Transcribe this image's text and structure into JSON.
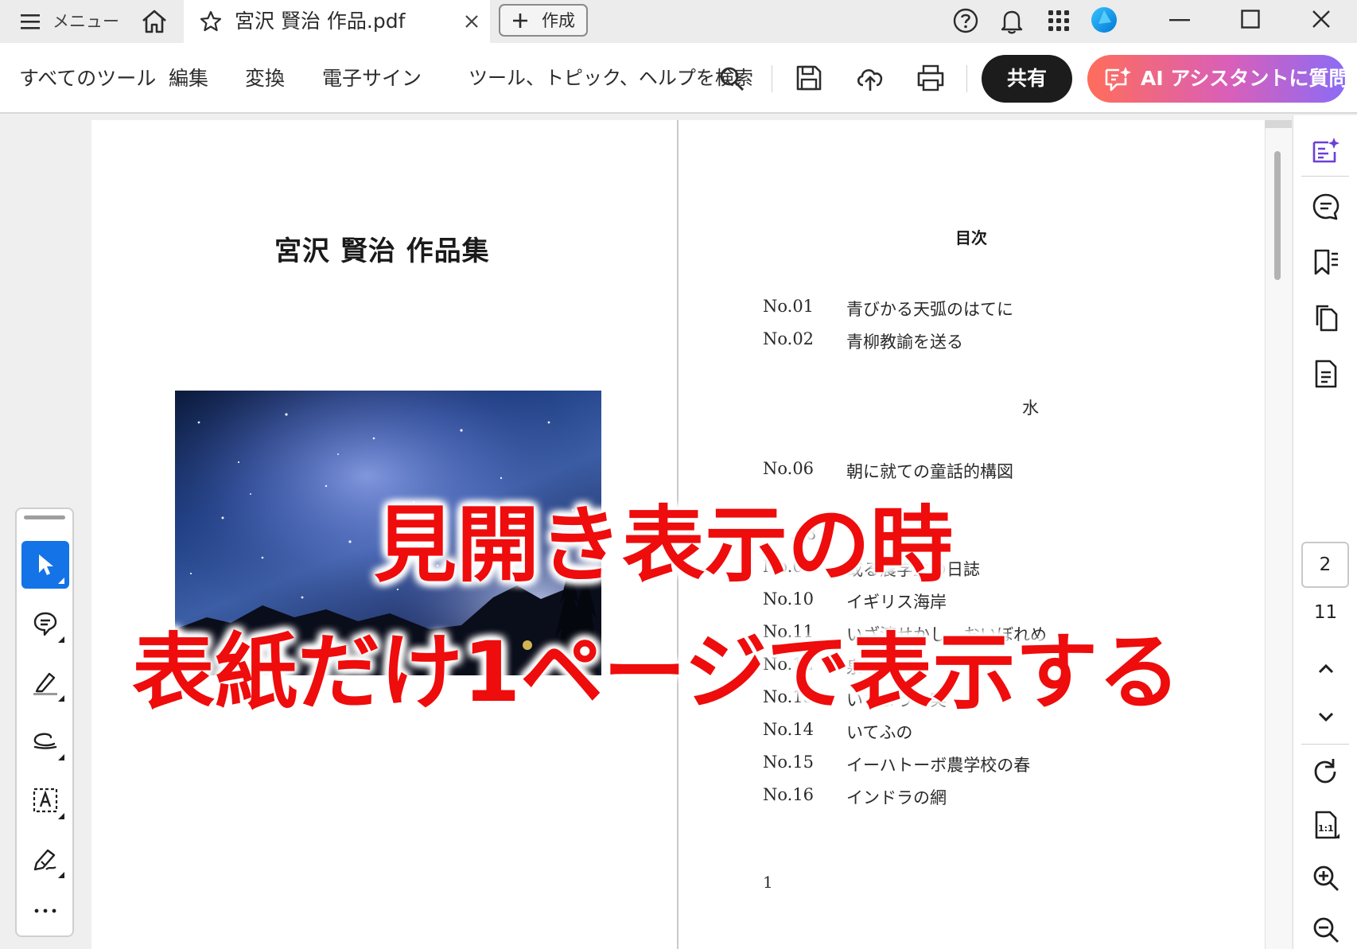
{
  "window": {
    "menu_label": "メニュー",
    "tab_title": "宮沢 賢治 作品.pdf",
    "create_label": "作成"
  },
  "toolbar": {
    "menus": [
      "すべてのツール",
      "編集",
      "変換",
      "電子サイン"
    ],
    "search_placeholder": "ツール、トピック、ヘルプを検索",
    "share_label": "共有",
    "ai_label": "AI アシスタントに質問"
  },
  "cover": {
    "title": "宮沢  賢治  作品集"
  },
  "toc": {
    "title": "目次",
    "items": [
      {
        "no": "No.01",
        "name": "青びかる天弧のはてに",
        "visible": true
      },
      {
        "no": "No.02",
        "name": "青柳教諭を送る",
        "visible": true
      },
      {
        "no": "No.06",
        "name": "朝に就ての童話的構図",
        "visible": true
      },
      {
        "no": "No.09",
        "name": "或る農学生の日誌",
        "visible": true
      },
      {
        "no": "No.10",
        "name": "イギリス海岸",
        "visible": true
      },
      {
        "no": "No.11",
        "name": "いざ渡せかし　おいぼれめ",
        "visible": true
      },
      {
        "no": "No.12",
        "name": "泉ある家",
        "visible": true
      },
      {
        "no": "No.13",
        "name": "いちょうの実",
        "visible": true
      },
      {
        "no": "No.14",
        "name": "いてふの",
        "visible": true
      },
      {
        "no": "No.15",
        "name": "イーハトーボ農学校の春",
        "visible": true
      },
      {
        "no": "No.16",
        "name": "インドラの網",
        "visible": true
      }
    ],
    "partial_text_1": "水",
    "partial_no_8": ".08",
    "page_number": "1"
  },
  "overlay": {
    "line1": "見開き表示の時",
    "line2": "表紙だけ1ページで表示する",
    "color": "#ee0c0c"
  },
  "navigation": {
    "current_page": "2",
    "total_pages": "11"
  },
  "colors": {
    "accent_blue": "#1473e6",
    "share_bg": "#1c1c1c",
    "ai_gradient_start": "#ff6d5a",
    "ai_gradient_end": "#8a6cf6",
    "rail_icon_purple": "#6b3fd6"
  },
  "icons": {
    "titlebar": [
      "hamburger-icon",
      "home-icon",
      "star-icon",
      "close-tab-icon",
      "plus-icon",
      "help-icon",
      "bell-icon",
      "apps-grid-icon",
      "account-avatar",
      "minimize-icon",
      "maximize-icon",
      "close-window-icon"
    ],
    "toolbar": [
      "search-icon",
      "save-icon",
      "upload-cloud-icon",
      "print-icon",
      "ai-sparkle-icon"
    ],
    "right_rail": [
      "ai-summary-icon",
      "comment-icon",
      "bookmark-icon",
      "pages-icon",
      "document-icon",
      "chevron-up-icon",
      "chevron-down-icon",
      "rotate-icon",
      "actual-size-icon",
      "zoom-in-icon",
      "zoom-out-icon"
    ],
    "palette": [
      "select-cursor-icon",
      "comment-add-icon",
      "highlighter-icon",
      "freehand-draw-icon",
      "text-box-icon",
      "signature-pen-icon",
      "more-icon"
    ]
  }
}
